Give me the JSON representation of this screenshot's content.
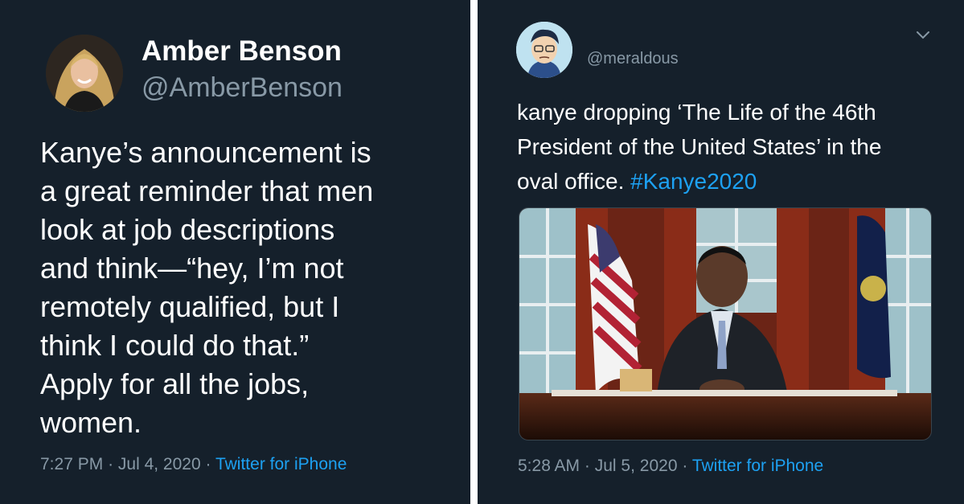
{
  "left_tweet": {
    "display_name": "Amber Benson",
    "handle": "@AmberBenson",
    "text_lines": [
      "Kanye’s announcement is",
      "a great reminder that men",
      "look at job descriptions",
      "and think—“hey, I’m not",
      "remotely qualified, but I",
      "think I could do that.”",
      "Apply for all the jobs,",
      "women."
    ],
    "time": "7:27 PM",
    "date": "Jul 4, 2020",
    "source": "Twitter for iPhone",
    "separator": "·"
  },
  "right_tweet": {
    "handle": "@meraldous",
    "text_lines": [
      "kanye dropping ‘The Life of the 46th",
      "President of the United States’ in the"
    ],
    "text_last_line": "oval office. ",
    "hashtag": "#Kanye2020",
    "time": "5:28 AM",
    "date": "Jul 5, 2020",
    "source": "Twitter for iPhone",
    "separator": "·"
  },
  "colors": {
    "background": "#15202b",
    "text": "#ffffff",
    "secondary": "#8899a6",
    "link": "#1da1f2"
  },
  "icons": {
    "menu": "chevron-down-icon"
  }
}
